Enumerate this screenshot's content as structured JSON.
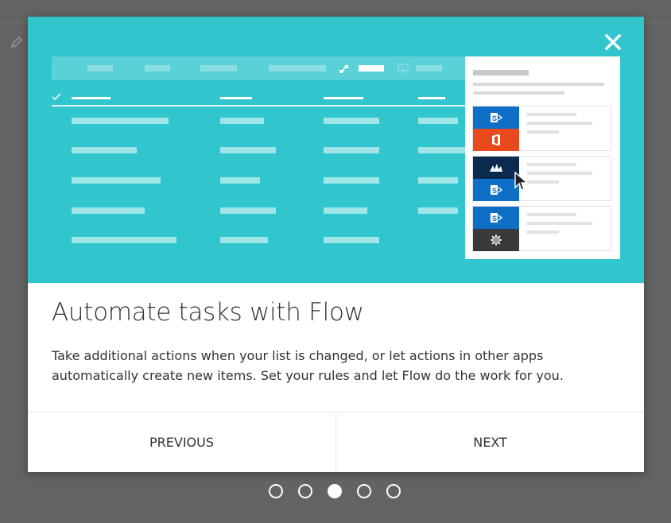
{
  "dialog": {
    "title": "Automate tasks with Flow",
    "description": "Take additional actions when your list is changed, or let actions in other apps automatically create new items. Set your rules and let Flow do the work for you.",
    "close_icon": "close-icon"
  },
  "navigation": {
    "previous_label": "PREVIOUS",
    "next_label": "NEXT"
  },
  "pagination": {
    "total": 5,
    "current": 3
  },
  "illustration": {
    "connectors": [
      "sharepoint-icon",
      "office-icon",
      "dynamics-icon",
      "sharepoint-icon",
      "sharepoint-icon",
      "gear-icon"
    ]
  },
  "colors": {
    "hero_background": "#31c6cd",
    "overlay": "#636363",
    "sharepoint_blue": "#0f6fc6",
    "office_orange": "#e8491d",
    "dynamics_navy": "#0b2a4f",
    "settings_dark": "#3a3a3a"
  }
}
